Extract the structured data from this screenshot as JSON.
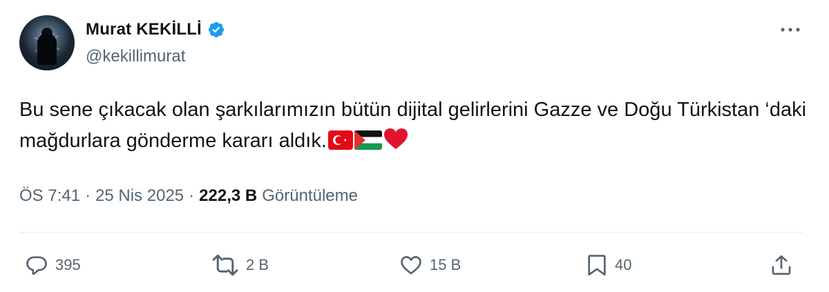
{
  "author": {
    "display_name": "Murat KEKİLLİ",
    "handle": "@kekillimurat",
    "verified": true,
    "avatar_icon": "profile-avatar"
  },
  "tweet": {
    "text": "Bu sene çıkacak olan şarkılarımızın bütün dijital gelirlerini Gazze ve Doğu Türkistan ‘daki mağdurlara gönderme kararı aldık.",
    "emoji": [
      "turkey-flag-icon",
      "palestine-flag-icon",
      "red-heart-icon"
    ]
  },
  "meta": {
    "time": "ÖS 7:41",
    "separator": "·",
    "date": "25 Nis 2025",
    "views_count": "222,3 B",
    "views_label": "Görüntüleme"
  },
  "actions": {
    "replies": "395",
    "reposts": "2 B",
    "likes": "15 B",
    "bookmarks": "40"
  },
  "colors": {
    "text_primary": "#0f1419",
    "text_secondary": "#536471",
    "verified_blue": "#1d9bf0",
    "divider": "#e5e9ec"
  }
}
